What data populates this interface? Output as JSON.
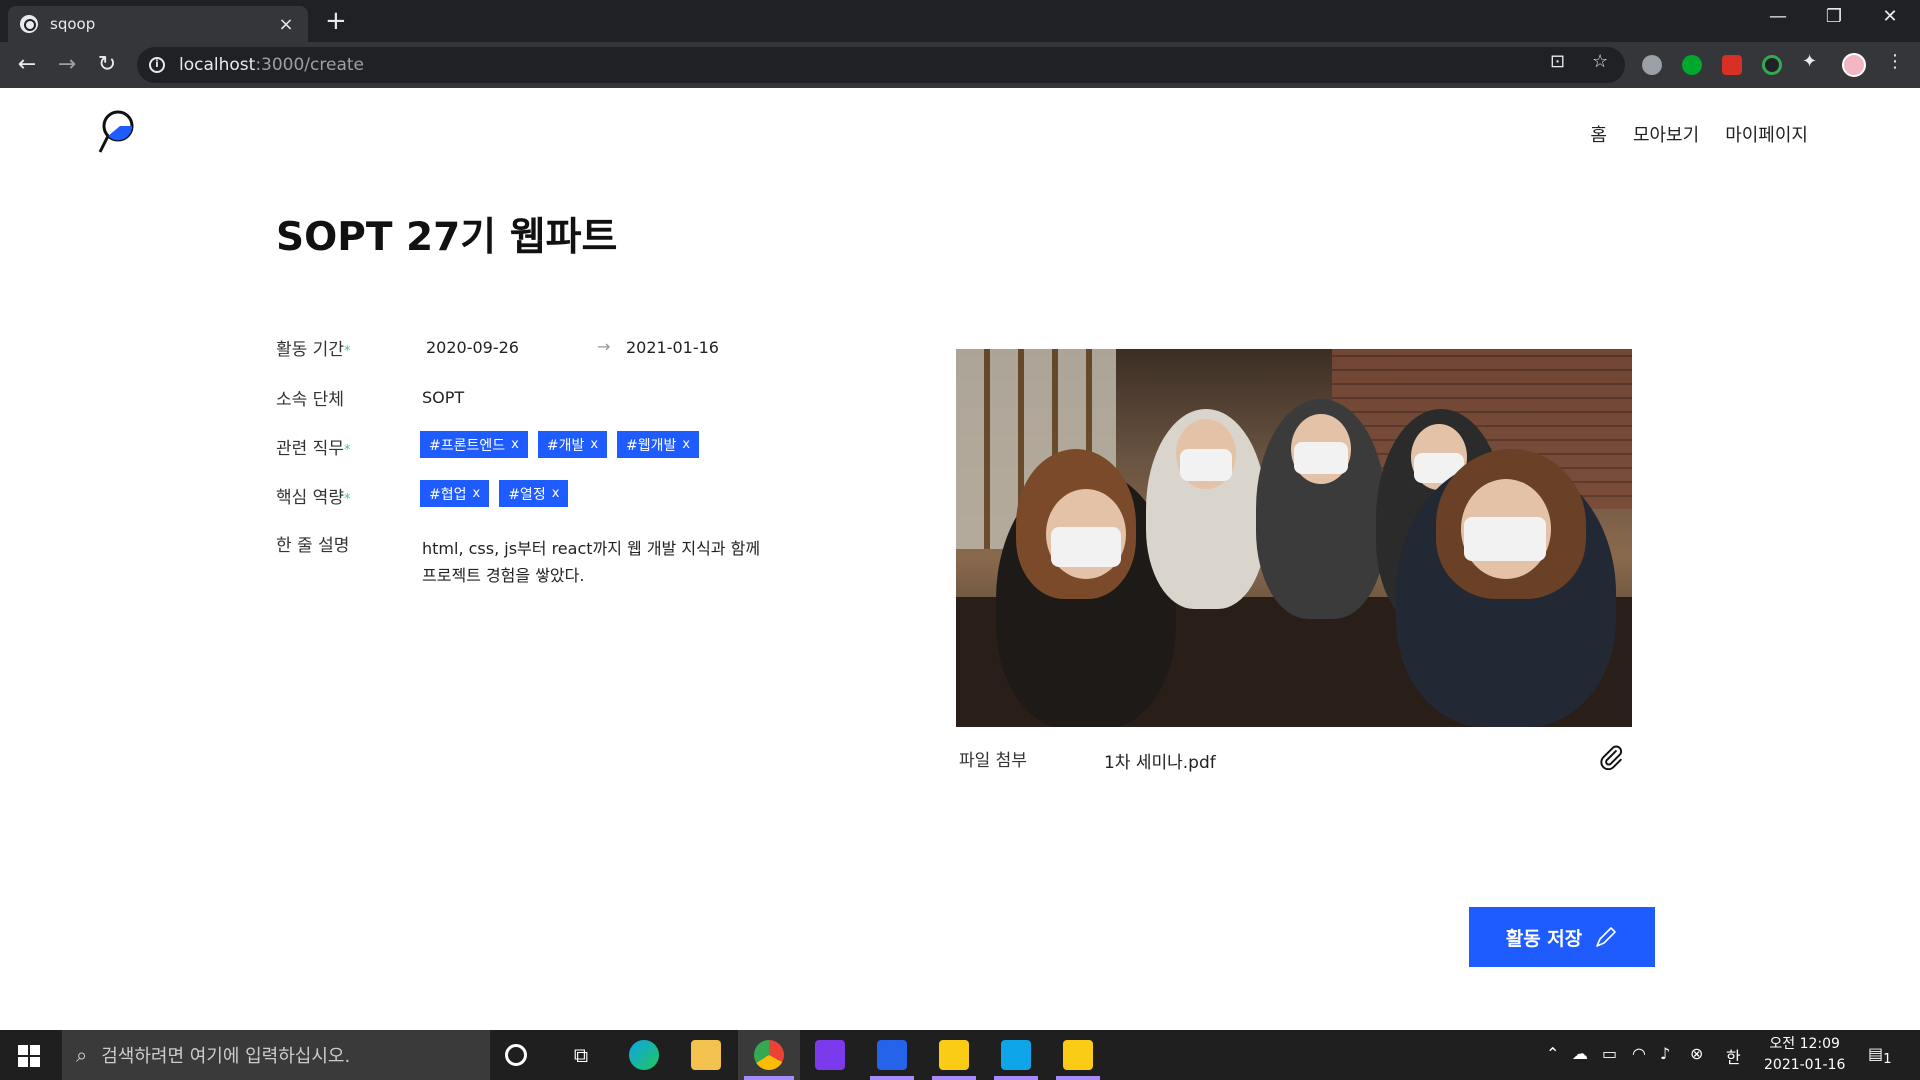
{
  "browser": {
    "tab_title": "sqoop",
    "url_host": "localhost",
    "url_path": ":3000/create"
  },
  "nav": {
    "home": "홈",
    "collection": "모아보기",
    "mypage": "마이페이지"
  },
  "activity": {
    "title": "SOPT 27기 웹파트",
    "period_label": "활동 기간",
    "start_date": "2020-09-26",
    "end_date": "2021-01-16",
    "org_label": "소속 단체",
    "org_value": "SOPT",
    "jobs_label": "관련 직무",
    "jobs": [
      "#프론트엔드",
      "#개발",
      "#웹개발"
    ],
    "skills_label": "핵심 역량",
    "skills": [
      "#협업",
      "#열정"
    ],
    "desc_label": "한 줄 설명",
    "desc_line1": "html, css, js부터 react까지 웹 개발 지식과 함께",
    "desc_line2": "프로젝트 경험을 쌓았다.",
    "required_mark": "*"
  },
  "file": {
    "label": "파일 첨부",
    "name": "1차 세미나.pdf"
  },
  "save_button": "활동 저장",
  "taskbar": {
    "search_placeholder": "검색하려면 여기에 입력하십시오.",
    "ime": "한",
    "time": "오전 12:09",
    "date": "2021-01-16",
    "notif_count": "1"
  },
  "colors": {
    "accent": "#1f5cff",
    "required": "#3ec88a"
  }
}
